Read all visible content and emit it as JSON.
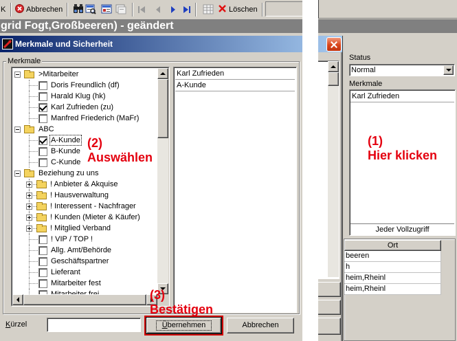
{
  "colors": {
    "window_bg": "#d4d0c8",
    "title_start": "#0a246a",
    "title_end": "#a6caf0",
    "record_bar": "#808080",
    "annotation": "#e4000f",
    "highlight": "#d40000"
  },
  "toolbar": {
    "ok_label": "K",
    "cancel": {
      "label": "Abbrechen",
      "icon": "cancel-circle-icon"
    },
    "tools": [
      {
        "icon": "binoculars-icon",
        "enabled": true
      },
      {
        "icon": "record-search-icon",
        "enabled": true
      },
      {
        "icon": "record-list-icon",
        "enabled": true
      },
      {
        "icon": "record-copy-icon",
        "enabled": false
      }
    ],
    "nav": [
      {
        "icon": "first-record-icon",
        "enabled": false
      },
      {
        "icon": "prev-record-icon",
        "enabled": false
      },
      {
        "icon": "next-record-icon",
        "enabled": true
      },
      {
        "icon": "last-record-icon",
        "enabled": true
      }
    ],
    "grid": {
      "icon": "table-icon",
      "enabled": false
    },
    "delete": {
      "label": "Löschen",
      "icon": "delete-x-icon"
    }
  },
  "record_title": "grid Fogt,Großbeeren) - geändert",
  "dialog": {
    "title": "Merkmale und Sicherheit",
    "group_label": "Merkmale",
    "tree": [
      {
        "label": ">Mitarbeiter",
        "depth": 0,
        "node": "folder",
        "expander": "collapse"
      },
      {
        "label": "Doris Freundlich (df)",
        "depth": 1,
        "node": "checkbox",
        "checked": false
      },
      {
        "label": "Harald Klug (hk)",
        "depth": 1,
        "node": "checkbox",
        "checked": false
      },
      {
        "label": "Karl Zufrieden (zu)",
        "depth": 1,
        "node": "checkbox",
        "checked": true
      },
      {
        "label": "Manfred Friederich (MaFr)",
        "depth": 1,
        "node": "checkbox",
        "checked": false
      },
      {
        "label": "ABC",
        "depth": 0,
        "node": "folder",
        "expander": "collapse"
      },
      {
        "label": "A-Kunde",
        "depth": 1,
        "node": "checkbox",
        "checked": true,
        "focused": true
      },
      {
        "label": "B-Kunde",
        "depth": 1,
        "node": "checkbox",
        "checked": false
      },
      {
        "label": "C-Kunde",
        "depth": 1,
        "node": "checkbox",
        "checked": false
      },
      {
        "label": "Beziehung zu uns",
        "depth": 0,
        "node": "folder",
        "expander": "collapse"
      },
      {
        "label": "! Anbieter & Akquise",
        "depth": 1,
        "node": "folder",
        "expander": "expand"
      },
      {
        "label": "! Hausverwaltung",
        "depth": 1,
        "node": "folder",
        "expander": "expand"
      },
      {
        "label": "! Interessent - Nachfrager",
        "depth": 1,
        "node": "folder",
        "expander": "expand"
      },
      {
        "label": "! Kunden (Mieter & Käufer)",
        "depth": 1,
        "node": "folder",
        "expander": "expand"
      },
      {
        "label": "! Mitglied Verband",
        "depth": 1,
        "node": "folder",
        "expander": "expand"
      },
      {
        "label": "! VIP / TOP !",
        "depth": 1,
        "node": "checkbox",
        "checked": false
      },
      {
        "label": "Allg. Amt/Behörde",
        "depth": 1,
        "node": "checkbox",
        "checked": false
      },
      {
        "label": "Geschäftspartner",
        "depth": 1,
        "node": "checkbox",
        "checked": false
      },
      {
        "label": "Lieferant",
        "depth": 1,
        "node": "checkbox",
        "checked": false
      },
      {
        "label": "Mitarbeiter fest",
        "depth": 1,
        "node": "checkbox",
        "checked": false
      },
      {
        "label": "Mitarbeiter frei",
        "depth": 1,
        "node": "checkbox",
        "checked": false
      }
    ],
    "selected_list": [
      "Karl Zufrieden",
      "A-Kunde"
    ],
    "kuerzel_label": "Kürzel",
    "kuerzel_value": "",
    "apply_label": "Übernehmen",
    "cancel_label": "Abbrechen"
  },
  "side_panel": {
    "status_label": "Status",
    "status_value": "Normal",
    "merkmale_label": "Merkmale",
    "merkmale_items": [
      "Karl Zufrieden"
    ],
    "access_label": "Jeder Vollzugriff",
    "table": {
      "header": "Ort",
      "rows": [
        "beeren",
        "h",
        "heim,Rheinl",
        "heim,Rheinl"
      ]
    }
  },
  "annotations": {
    "step1": {
      "number": "(1)",
      "text": "Hier klicken"
    },
    "step2": {
      "number": "(2)",
      "text": "Auswählen"
    },
    "step3": {
      "number": "(3)",
      "text": "Bestätigen"
    }
  }
}
